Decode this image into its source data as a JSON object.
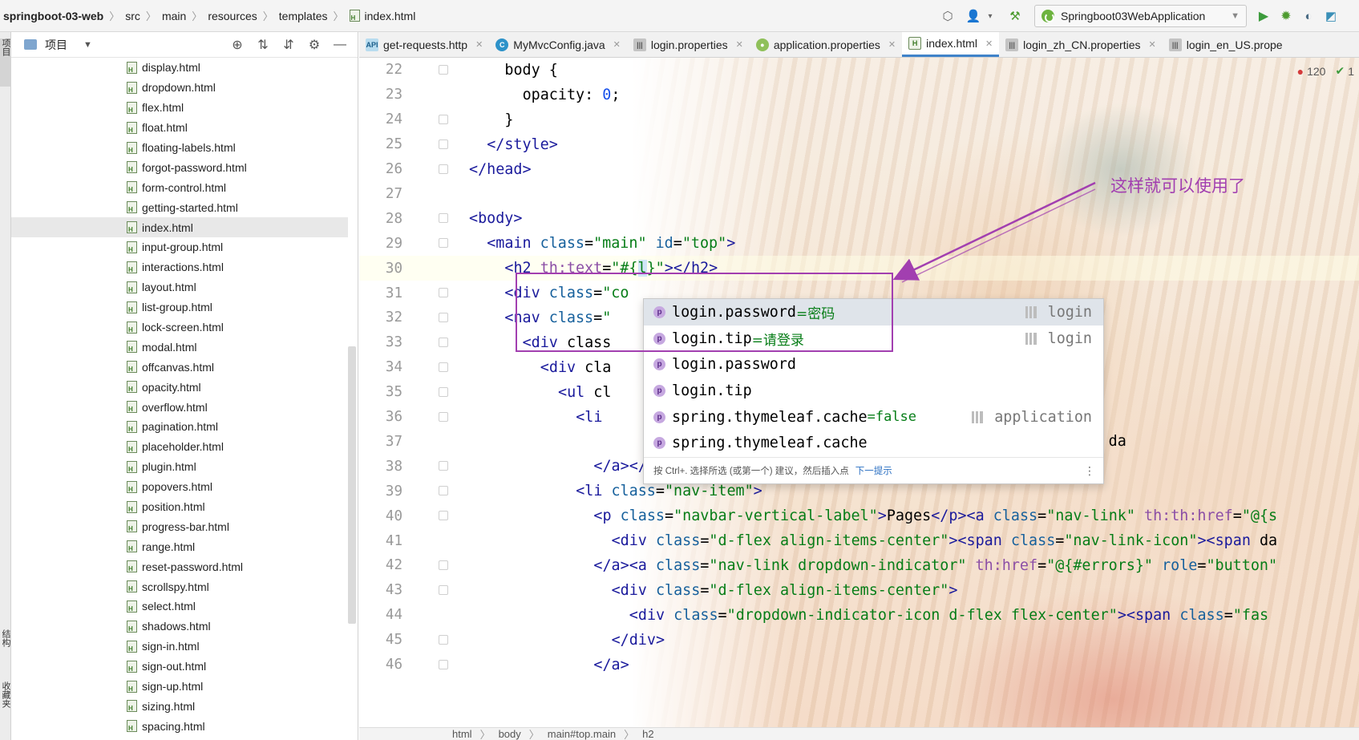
{
  "navbar": {
    "breadcrumb": [
      "springboot-03-web",
      "src",
      "main",
      "resources",
      "templates",
      "index.html"
    ],
    "run_config": "Springboot03WebApplication"
  },
  "side_strip": {
    "project_tab": "项目",
    "structure_tab": "结构",
    "favorites_tab": "收藏夹"
  },
  "project_panel": {
    "title": "项目",
    "files": [
      "display.html",
      "dropdown.html",
      "flex.html",
      "float.html",
      "floating-labels.html",
      "forgot-password.html",
      "form-control.html",
      "getting-started.html",
      "index.html",
      "input-group.html",
      "interactions.html",
      "layout.html",
      "list-group.html",
      "lock-screen.html",
      "modal.html",
      "offcanvas.html",
      "opacity.html",
      "overflow.html",
      "pagination.html",
      "placeholder.html",
      "plugin.html",
      "popovers.html",
      "position.html",
      "progress-bar.html",
      "range.html",
      "reset-password.html",
      "scrollspy.html",
      "select.html",
      "shadows.html",
      "sign-in.html",
      "sign-out.html",
      "sign-up.html",
      "sizing.html",
      "spacing.html"
    ],
    "selected": "index.html"
  },
  "editor_tabs": [
    {
      "label": "get-requests.http",
      "icon": "api-icon",
      "active": false
    },
    {
      "label": "MyMvcConfig.java",
      "icon": "class-icon",
      "active": false
    },
    {
      "label": "login.properties",
      "icon": "properties-icon",
      "active": false
    },
    {
      "label": "application.properties",
      "icon": "spring-properties-icon",
      "active": false
    },
    {
      "label": "index.html",
      "icon": "html-icon",
      "active": true
    },
    {
      "label": "login_zh_CN.properties",
      "icon": "properties-icon",
      "active": false
    },
    {
      "label": "login_en_US.prope",
      "icon": "properties-icon",
      "active": false
    }
  ],
  "problems": {
    "errors": "120",
    "checks": "1"
  },
  "code_lines": [
    {
      "n": "22",
      "indent": 2,
      "code": "body {"
    },
    {
      "n": "23",
      "indent": 3,
      "code": "opacity: 0;"
    },
    {
      "n": "24",
      "indent": 2,
      "code": "}"
    },
    {
      "n": "25",
      "indent": 1,
      "code": "</style>"
    },
    {
      "n": "26",
      "indent": 0,
      "code": "</head>"
    },
    {
      "n": "27",
      "indent": 0,
      "code": ""
    },
    {
      "n": "28",
      "indent": 0,
      "code": "<body>"
    },
    {
      "n": "29",
      "indent": 1,
      "code": "<main class=\"main\" id=\"top\">"
    },
    {
      "n": "30",
      "indent": 2,
      "code": "<h2 th:text=\"#{l}\"></h2>"
    },
    {
      "n": "31",
      "indent": 2,
      "code": "<div class=\"co"
    },
    {
      "n": "32",
      "indent": 2,
      "code": "<nav class=\"                         nt navbar-expand-lg\">"
    },
    {
      "n": "33",
      "indent": 3,
      "code": "<div class                          llapse\">"
    },
    {
      "n": "34",
      "indent": 4,
      "code": "<div cla"
    },
    {
      "n": "35",
      "indent": 5,
      "code": "<ul cl                           av\">"
    },
    {
      "n": "36",
      "indent": 6,
      "code": "<li                              ref=\"{}\">"
    },
    {
      "n": "37",
      "indent": 7,
      "code": "                                 ss=\"nav-link-icon\"><span da"
    },
    {
      "n": "38",
      "indent": 7,
      "code": "</a></li>"
    },
    {
      "n": "39",
      "indent": 6,
      "code": "<li class=\"nav-item\">"
    },
    {
      "n": "40",
      "indent": 7,
      "code": "<p class=\"navbar-vertical-label\">Pages</p><a class=\"nav-link\" th:th:href=\"@{s"
    },
    {
      "n": "41",
      "indent": 8,
      "code": "<div class=\"d-flex align-items-center\"><span class=\"nav-link-icon\"><span da"
    },
    {
      "n": "42",
      "indent": 7,
      "code": "</a><a class=\"nav-link dropdown-indicator\" th:href=\"@{#errors}\" role=\"button\""
    },
    {
      "n": "43",
      "indent": 8,
      "code": "<div class=\"d-flex align-items-center\">"
    },
    {
      "n": "44",
      "indent": 9,
      "code": "<div class=\"dropdown-indicator-icon d-flex flex-center\"><span class=\"fas"
    },
    {
      "n": "45",
      "indent": 8,
      "code": "</div>"
    },
    {
      "n": "46",
      "indent": 7,
      "code": "</a>"
    }
  ],
  "completion": {
    "items": [
      {
        "key": "login.password",
        "value": "=密码",
        "source": "login",
        "selected": true
      },
      {
        "key": "login.tip",
        "value": "=请登录",
        "source": "login",
        "selected": false
      },
      {
        "key": "login.password",
        "value": "",
        "source": "",
        "selected": false
      },
      {
        "key": "login.tip",
        "value": "",
        "source": "",
        "selected": false
      },
      {
        "key": "spring.thymeleaf.cache",
        "value": "=false",
        "source": "application",
        "selected": false
      },
      {
        "key": "spring.thymeleaf.cache",
        "value": "",
        "source": "",
        "selected": false
      }
    ],
    "hint": "按 Ctrl+. 选择所选 (或第一个) 建议，然后插入点",
    "hint_link": "下一提示"
  },
  "code_breadcrumb": [
    "html",
    "body",
    "main#top.main",
    "h2"
  ],
  "annotation": {
    "text": "这样就可以使用了",
    "color": "#a23fb0"
  }
}
